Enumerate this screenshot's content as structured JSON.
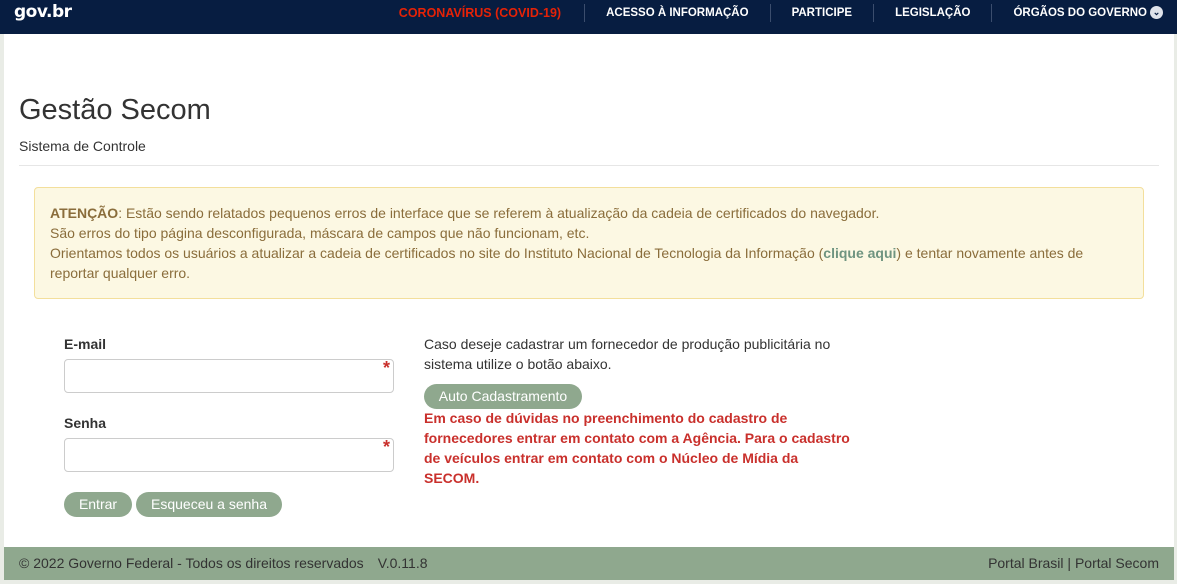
{
  "header": {
    "logo_gov": "gov",
    "logo_br": ".br",
    "nav": [
      {
        "label": "CORONAVÍRUS (COVID-19)"
      },
      {
        "label": "ACESSO À INFORMAÇÃO"
      },
      {
        "label": "PARTICIPE"
      },
      {
        "label": "LEGISLAÇÃO"
      },
      {
        "label": "ÓRGÃOS DO GOVERNO"
      }
    ]
  },
  "main": {
    "title": "Gestão Secom",
    "subtitle": "Sistema de Controle"
  },
  "alert": {
    "strong": "ATENÇÃO",
    "line1_rest": ": Estão sendo relatados pequenos erros de interface que se referem à atualização da cadeia de certificados do navegador.",
    "line2": "São erros do tipo página desconfigurada, máscara de campos que não funcionam, etc.",
    "line3_start": "Orientamos todos os usuários a atualizar a cadeia de certificados no site do Instituto Nacional de Tecnologia da Informação (",
    "link_text": "clique aqui",
    "line3_end": ") e tentar novamente antes de reportar qualquer erro."
  },
  "login": {
    "email_label": "E-mail",
    "email_value": "",
    "password_label": "Senha",
    "password_value": "",
    "required_mark": "*",
    "submit_label": "Entrar",
    "forgot_label": "Esqueceu a senha"
  },
  "register": {
    "info": "Caso deseje cadastrar um fornecedor de produção publicitária no sistema utilize o botão abaixo.",
    "button_label": "Auto Cadastramento",
    "warning": "Em caso de dúvidas no preenchimento do cadastro de fornecedores entrar em contato com a Agência. Para o cadastro de veículos entrar em contato com o Núcleo de Mídia da SECOM."
  },
  "footer": {
    "copyright": "© 2022 Governo Federal - Todos os direitos reservados",
    "version": "V.0.11.8",
    "link1": "Portal Brasil",
    "separator": " | ",
    "link2": "Portal Secom"
  },
  "colors": {
    "header_bg": "#071d41",
    "covid_red": "#e52207",
    "button_green": "#8fa88e",
    "warning_red": "#c9302c",
    "alert_bg": "#fcf8e3"
  }
}
